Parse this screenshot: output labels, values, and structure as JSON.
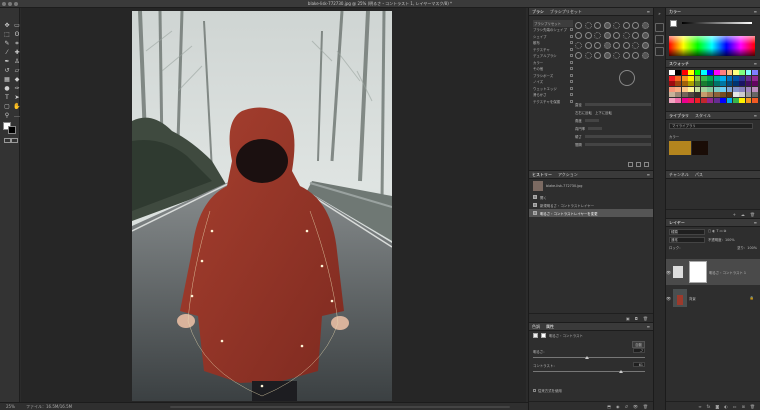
{
  "window": {
    "title": "blake-lisk-772730.jpg @ 25% (明るさ・コントラスト 1, レイヤーマスク/8) *"
  },
  "tools": [
    {
      "name": "move-tool-icon",
      "glyph": "✥"
    },
    {
      "name": "artboard-tool-icon",
      "glyph": "▭"
    },
    {
      "name": "marquee-tool-icon",
      "glyph": "⬚"
    },
    {
      "name": "lasso-tool-icon",
      "glyph": "ʘ"
    },
    {
      "name": "quick-select-tool-icon",
      "glyph": "✎"
    },
    {
      "name": "crop-tool-icon",
      "glyph": "⌗"
    },
    {
      "name": "eyedropper-tool-icon",
      "glyph": "⁄"
    },
    {
      "name": "heal-tool-icon",
      "glyph": "✚"
    },
    {
      "name": "brush-tool-icon",
      "glyph": "✒"
    },
    {
      "name": "stamp-tool-icon",
      "glyph": "♙"
    },
    {
      "name": "history-brush-icon",
      "glyph": "↺"
    },
    {
      "name": "eraser-tool-icon",
      "glyph": "▱"
    },
    {
      "name": "gradient-tool-icon",
      "glyph": "▦"
    },
    {
      "name": "blur-tool-icon",
      "glyph": "◆"
    },
    {
      "name": "dodge-tool-icon",
      "glyph": "●"
    },
    {
      "name": "pen-tool-icon",
      "glyph": "✑"
    },
    {
      "name": "type-tool-icon",
      "glyph": "T"
    },
    {
      "name": "path-select-icon",
      "glyph": "➤"
    },
    {
      "name": "shape-tool-icon",
      "glyph": "▢"
    },
    {
      "name": "hand-tool-icon",
      "glyph": "✋"
    },
    {
      "name": "zoom-tool-icon",
      "glyph": "⚲"
    },
    {
      "name": "more-tools-icon",
      "glyph": "…"
    }
  ],
  "brush_panel": {
    "tabs": [
      "ブラシ",
      "ブラシプリセット"
    ],
    "button": "ブラシプリセット",
    "items": [
      "ブラシ先端のシェイプ",
      "シェイプ",
      "散布",
      "テクスチャ",
      "デュアルブラシ",
      "カラー",
      "その他",
      "ブラシポーズ",
      "ノイズ",
      "ウェットエッジ",
      "滑らかさ",
      "テクスチャを保護"
    ],
    "size_label": "直径",
    "controls": [
      "左右に反転",
      "上下に反転",
      "角度",
      "真円率",
      "硬さ",
      "間隔"
    ]
  },
  "history_panel": {
    "tabs": [
      "ヒストリー",
      "アクション"
    ],
    "snapshot": "blake-lisk-772730.jpg",
    "steps": [
      "開く",
      "新規明るさ・コントラストレイヤー",
      "明るさ・コントラストレイヤーを変更"
    ],
    "selected_index": 2
  },
  "properties_panel": {
    "tabs": [
      "色調",
      "属性"
    ],
    "title": "明るさ・コントラスト",
    "auto_label": "自動",
    "brightness_label": "明るさ：",
    "brightness_value": "-7",
    "brightness_level": 0.48,
    "contrast_label": "コントラスト：",
    "contrast_value": "61",
    "contrast_level": 0.78,
    "legacy_label": "従来方式を使用"
  },
  "color_panel": {
    "tab": "カラー",
    "fg": "#ffffff"
  },
  "swatches_panel": {
    "tab": "スウォッチ",
    "colors": [
      "#ffffff",
      "#000000",
      "#ff0000",
      "#ffff00",
      "#00ff00",
      "#00ffff",
      "#0000ff",
      "#ff00ff",
      "#ff7f7f",
      "#ffbf7f",
      "#ffff7f",
      "#7fff7f",
      "#7fffff",
      "#7f7fff",
      "#ed1c24",
      "#f26522",
      "#f7941d",
      "#fff200",
      "#8dc63f",
      "#39b54a",
      "#00a651",
      "#00a99d",
      "#00aeef",
      "#0072bc",
      "#0054a6",
      "#2e3192",
      "#662d91",
      "#92278f",
      "#9e0b0f",
      "#a0410d",
      "#a36209",
      "#aba000",
      "#598527",
      "#1a7b30",
      "#007236",
      "#00746b",
      "#0076a3",
      "#004b80",
      "#003471",
      "#1b1464",
      "#440e62",
      "#630460",
      "#f69679",
      "#f9ad81",
      "#fdc68a",
      "#fff799",
      "#c4df9b",
      "#a3d39c",
      "#82ca9d",
      "#7accc8",
      "#6dcff6",
      "#7da7d9",
      "#8393ca",
      "#8781bd",
      "#a186be",
      "#bd8cbf",
      "#c7b299",
      "#998675",
      "#736357",
      "#534741",
      "#37302a",
      "#c69c6d",
      "#a67c52",
      "#8c6239",
      "#754c24",
      "#603913",
      "#e6e6e6",
      "#cccccc",
      "#999999",
      "#666666",
      "#f1a5c0",
      "#f06eaa",
      "#ec008c",
      "#ed145b",
      "#ee1d23",
      "#c1272d",
      "#92278f",
      "#662d91",
      "#0000ff",
      "#00aeef",
      "#39b54a",
      "#fff200",
      "#f7941d",
      "#f15a24"
    ]
  },
  "libraries_panel": {
    "tabs": [
      "ライブラリ",
      "スタイル"
    ],
    "library": "マイライブラリ",
    "section": "カラー",
    "colors": [
      "#b4851e",
      "#1a0d07"
    ]
  },
  "channels_tab": {
    "tabs": [
      "チャンネル",
      "パス"
    ]
  },
  "layers_panel": {
    "tab": "レイヤー",
    "kind": "種類",
    "mode": "通常",
    "opacity_label": "不透明度：100%",
    "fill_label": "塗り：100%",
    "lock_label": "ロック：",
    "layers": [
      {
        "name": "明るさ・コントラスト 1",
        "type": "adjustment",
        "selected": true
      },
      {
        "name": "背景",
        "type": "image",
        "selected": false
      }
    ]
  },
  "status": {
    "zoom": "25%",
    "info": "ファイル：16.5M/16.5M"
  }
}
